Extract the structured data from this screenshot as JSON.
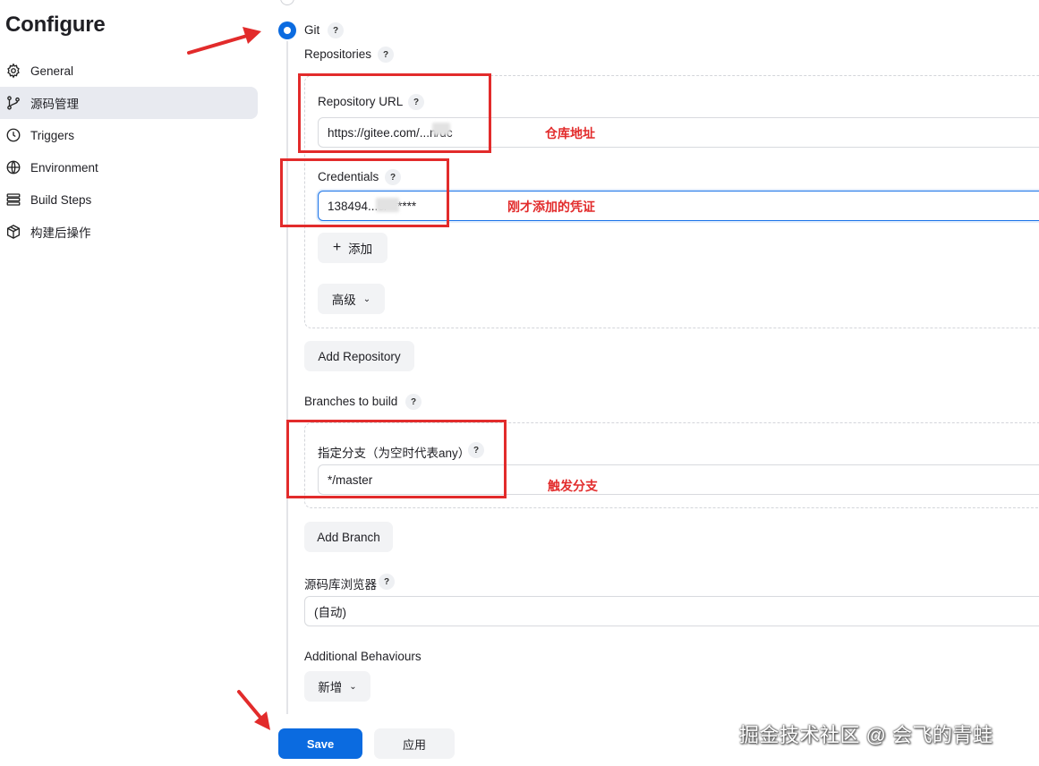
{
  "page": {
    "title": "Configure"
  },
  "sidebar": {
    "items": [
      {
        "label": "General",
        "icon": "gear-icon"
      },
      {
        "label": "源码管理",
        "icon": "branch-icon",
        "active": true
      },
      {
        "label": "Triggers",
        "icon": "clock-icon"
      },
      {
        "label": "Environment",
        "icon": "globe-icon"
      },
      {
        "label": "Build Steps",
        "icon": "list-icon"
      },
      {
        "label": "构建后操作",
        "icon": "package-icon"
      }
    ]
  },
  "scm": {
    "option_label": "Git",
    "repositories_label": "Repositories",
    "repo_url_label": "Repository URL",
    "repo_url_value": "https://gitee.com/...n/dc",
    "credentials_label": "Credentials",
    "credentials_value": "138494...5/******",
    "add_button": "添加",
    "advanced_button": "高级",
    "add_repository_button": "Add Repository",
    "branches_label": "Branches to build",
    "branch_specifier_label": "指定分支（为空时代表any）",
    "branch_value": "*/master",
    "add_branch_button": "Add Branch",
    "repo_browser_label": "源码库浏览器",
    "repo_browser_value": "(自动)",
    "additional_behaviours_label": "Additional Behaviours",
    "new_button": "新增",
    "help_glyph": "?"
  },
  "annotations": {
    "repo_url": "仓库地址",
    "credentials": "刚才添加的凭证",
    "branch": "触发分支",
    "color": "#e22b2b"
  },
  "footer": {
    "save": "Save",
    "apply": "应用"
  },
  "watermark": "掘金技术社区 @ 会飞的青蛙",
  "colors": {
    "primary": "#0b6be0",
    "active_nav": "#e8eaf0"
  }
}
